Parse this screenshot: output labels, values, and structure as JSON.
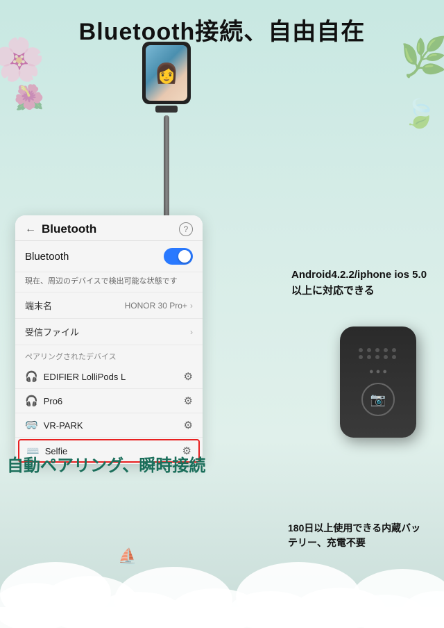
{
  "page": {
    "title": "Bluetooth接続、自由自在",
    "background_color": "#c8e8e2"
  },
  "header": {
    "back_arrow": "←",
    "title": "Bluetooth",
    "help_icon": "?"
  },
  "bluetooth_panel": {
    "toggle_label": "Bluetooth",
    "status_text": "現在、周辺のデバイスで検出可能な状態です",
    "device_name_label": "端末名",
    "device_name_value": "HONOR 30 Pro+",
    "receive_file_label": "受信ファイル",
    "paired_section_title": "ペアリングされたデバイス",
    "devices": [
      {
        "icon": "🎧",
        "name": "EDIFIER LolliPods L"
      },
      {
        "icon": "🎧",
        "name": "Pro6"
      },
      {
        "icon": "🥽",
        "name": "VR-PARK"
      },
      {
        "icon": "⌨️",
        "name": "Selfie",
        "highlighted": true
      }
    ]
  },
  "info_text_1": {
    "line1": "Android4.2.2/iphone ios 5.0",
    "line2": "以上に対応できる"
  },
  "info_text_2": {
    "line1": "180日以上使用できる内蔵バッ",
    "line2": "テリー、充電不要"
  },
  "auto_pair_text": "自動ペアリング、瞬時接続",
  "icons": {
    "back": "←",
    "help": "?",
    "gear": "⚙",
    "chevron": "›",
    "camera": "📷",
    "sailboat": "⛵"
  }
}
